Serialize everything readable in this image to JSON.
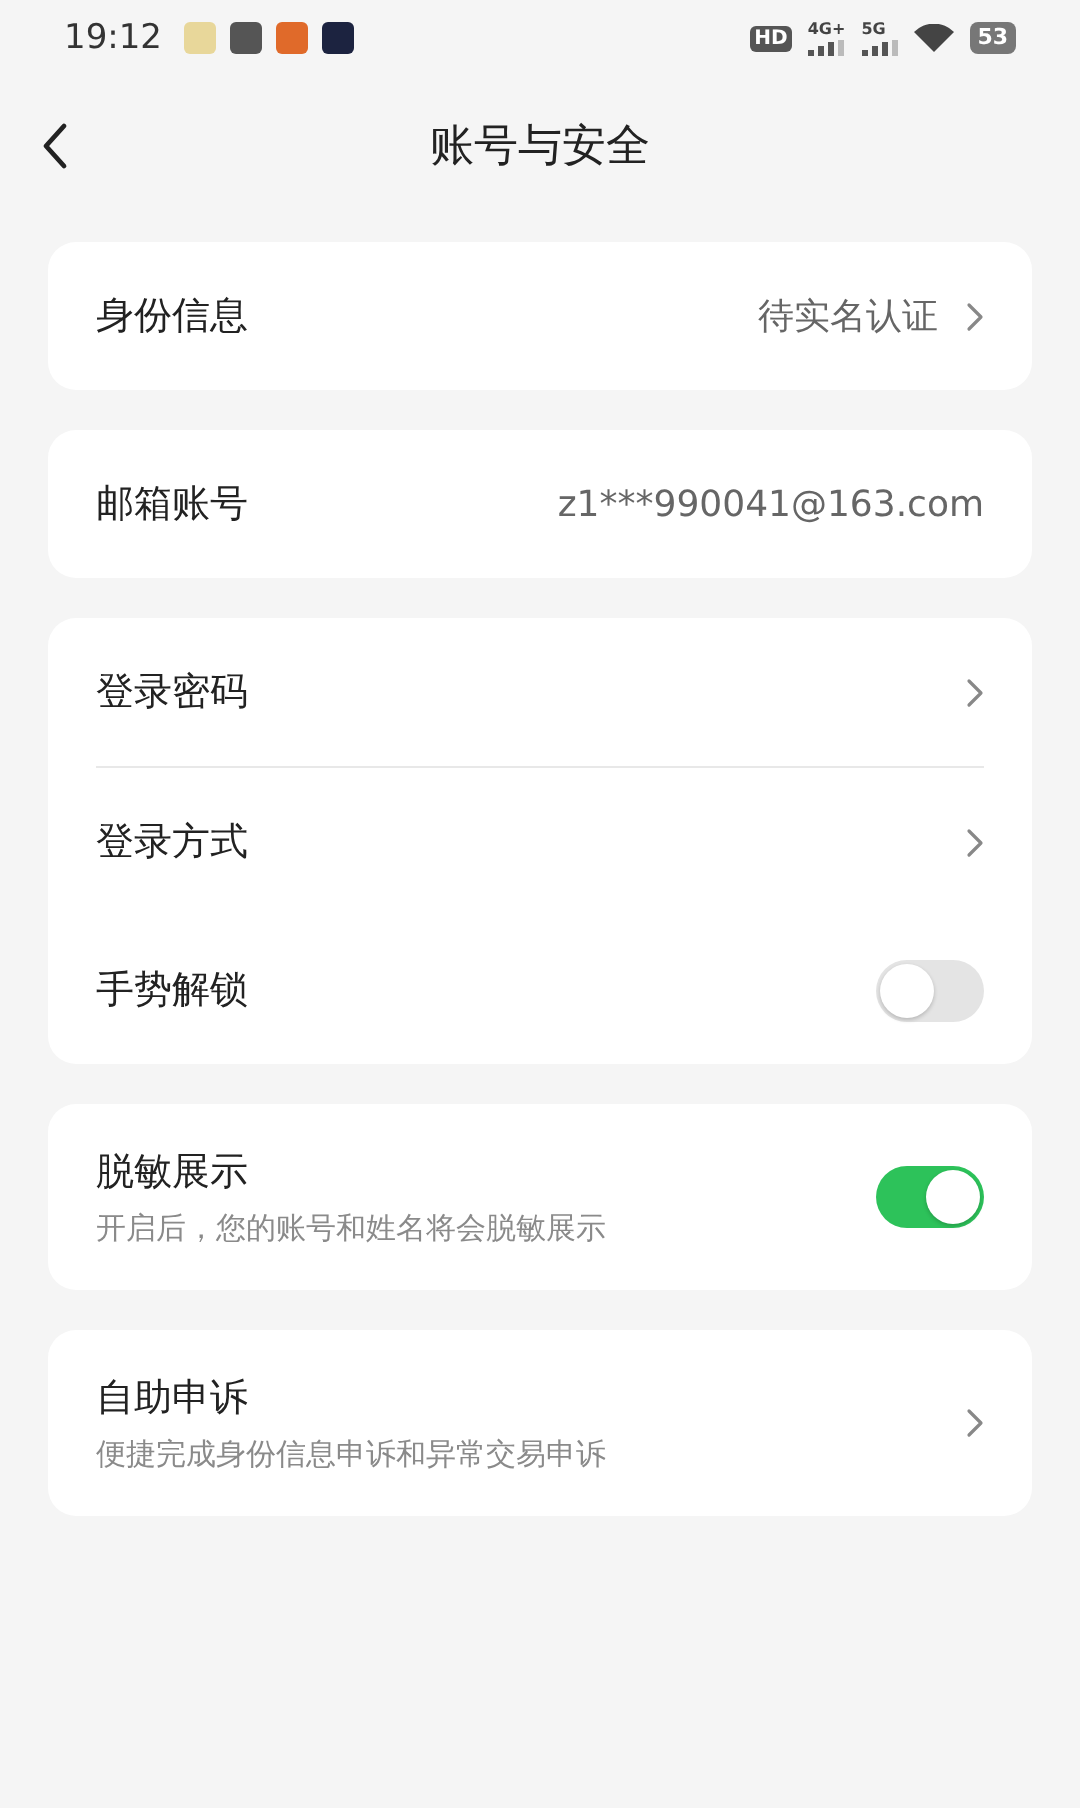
{
  "status_bar": {
    "time": "19:12",
    "network": [
      "4G+",
      "5G"
    ],
    "battery": "53",
    "hd_sim": "HD"
  },
  "header": {
    "title": "账号与安全"
  },
  "sections": [
    {
      "rows": [
        {
          "kind": "link",
          "label": "身份信息",
          "value": "待实名认证"
        }
      ]
    },
    {
      "rows": [
        {
          "kind": "value",
          "label": "邮箱账号",
          "value": "z1***990041@163.com"
        }
      ]
    },
    {
      "rows": [
        {
          "kind": "link",
          "label": "登录密码"
        },
        {
          "kind": "link",
          "label": "登录方式"
        },
        {
          "kind": "toggle",
          "label": "手势解锁",
          "on": false
        }
      ]
    },
    {
      "rows": [
        {
          "kind": "toggle",
          "label": "脱敏展示",
          "subtitle": "开启后，您的账号和姓名将会脱敏展示",
          "on": true
        }
      ]
    },
    {
      "rows": [
        {
          "kind": "link",
          "label": "自助申诉",
          "subtitle": "便捷完成身份信息申诉和异常交易申诉"
        }
      ]
    }
  ]
}
